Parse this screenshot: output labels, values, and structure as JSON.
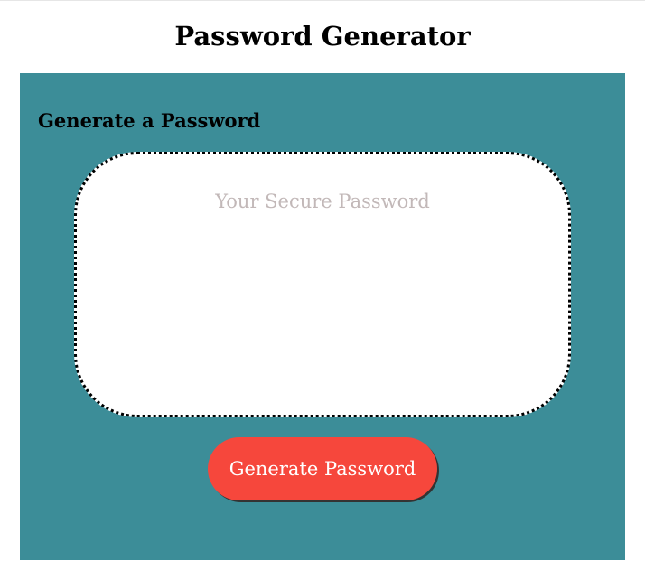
{
  "page": {
    "title": "Password Generator"
  },
  "card": {
    "heading": "Generate a Password",
    "background_color": "#3c8d98"
  },
  "password_field": {
    "placeholder": "Your Secure Password",
    "value": ""
  },
  "generate_button": {
    "label": "Generate Password",
    "color": "#f6473c"
  }
}
